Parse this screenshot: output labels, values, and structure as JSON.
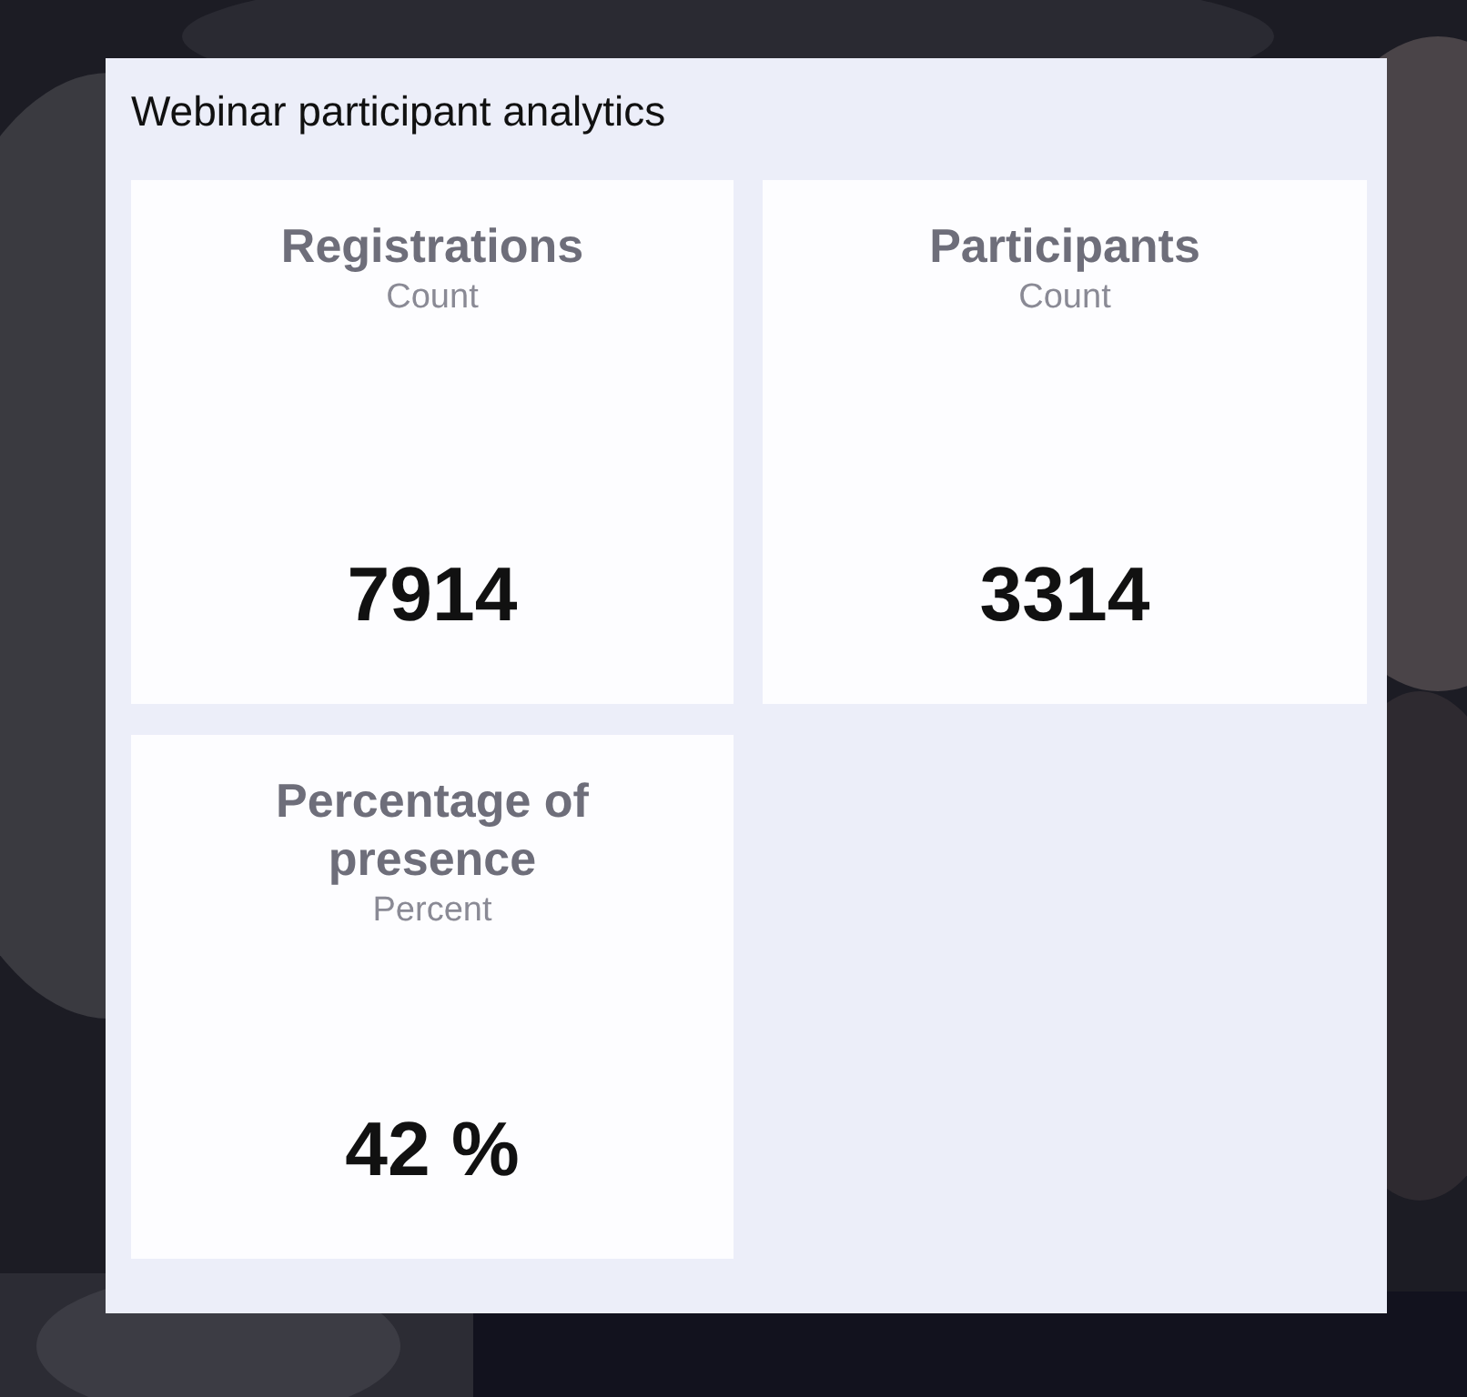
{
  "panel": {
    "title": "Webinar participant analytics",
    "cards": [
      {
        "title": "Registrations",
        "unit": "Count",
        "value": "7914"
      },
      {
        "title": "Participants",
        "unit": "Count",
        "value": "3314"
      },
      {
        "title": "Percentage of presence",
        "unit": "Percent",
        "value": "42 %"
      }
    ]
  }
}
